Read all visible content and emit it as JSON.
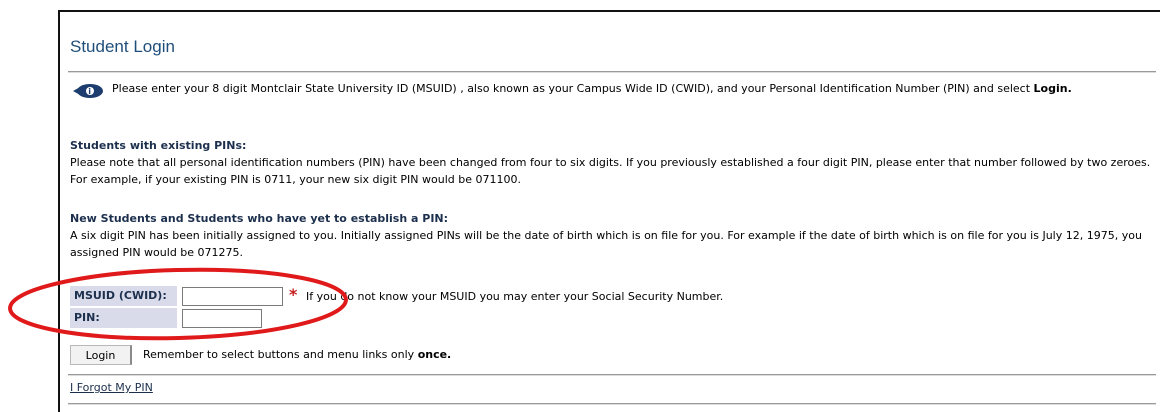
{
  "page": {
    "title": "Student Login"
  },
  "info": {
    "icon": "info-icon",
    "text_prefix": "Please enter your 8 digit Montclair State University ID (MSUID) , also known as your Campus Wide ID (CWID), and your Personal Identification Number (PIN) and select ",
    "text_bold": "Login."
  },
  "existing": {
    "heading": "Students with existing PINs:",
    "body": "Please note that all personal identification numbers (PIN) have been changed from four to six digits. If you previously established a four digit PIN, please enter that number followed by two zeroes. For example, if your existing PIN is 0711, your new six digit PIN would be 071100."
  },
  "new_students": {
    "heading": "New Students and Students who have yet to establish a PIN:",
    "body": "A six digit PIN has been initially assigned to you. Initially assigned PINs will be the date of birth which is on file for you. For example if the date of birth which is on file for you is July 12, 1975, you assigned PIN would be 071275."
  },
  "form": {
    "msuid_label": "MSUID (CWID):",
    "msuid_value": "",
    "required_marker": "*",
    "msuid_hint": "If you do not know your MSUID you may enter your Social Security Number.",
    "pin_label": "PIN:",
    "pin_value": ""
  },
  "actions": {
    "login_label": "Login",
    "remember_prefix": "Remember to select buttons and menu links only ",
    "remember_bold": "once.",
    "forgot_link": "I Forgot My PIN"
  },
  "colors": {
    "title": "#1f4e7a",
    "label_bg": "#d9dbea",
    "annotation": "#e0191a",
    "required": "#c62020"
  }
}
